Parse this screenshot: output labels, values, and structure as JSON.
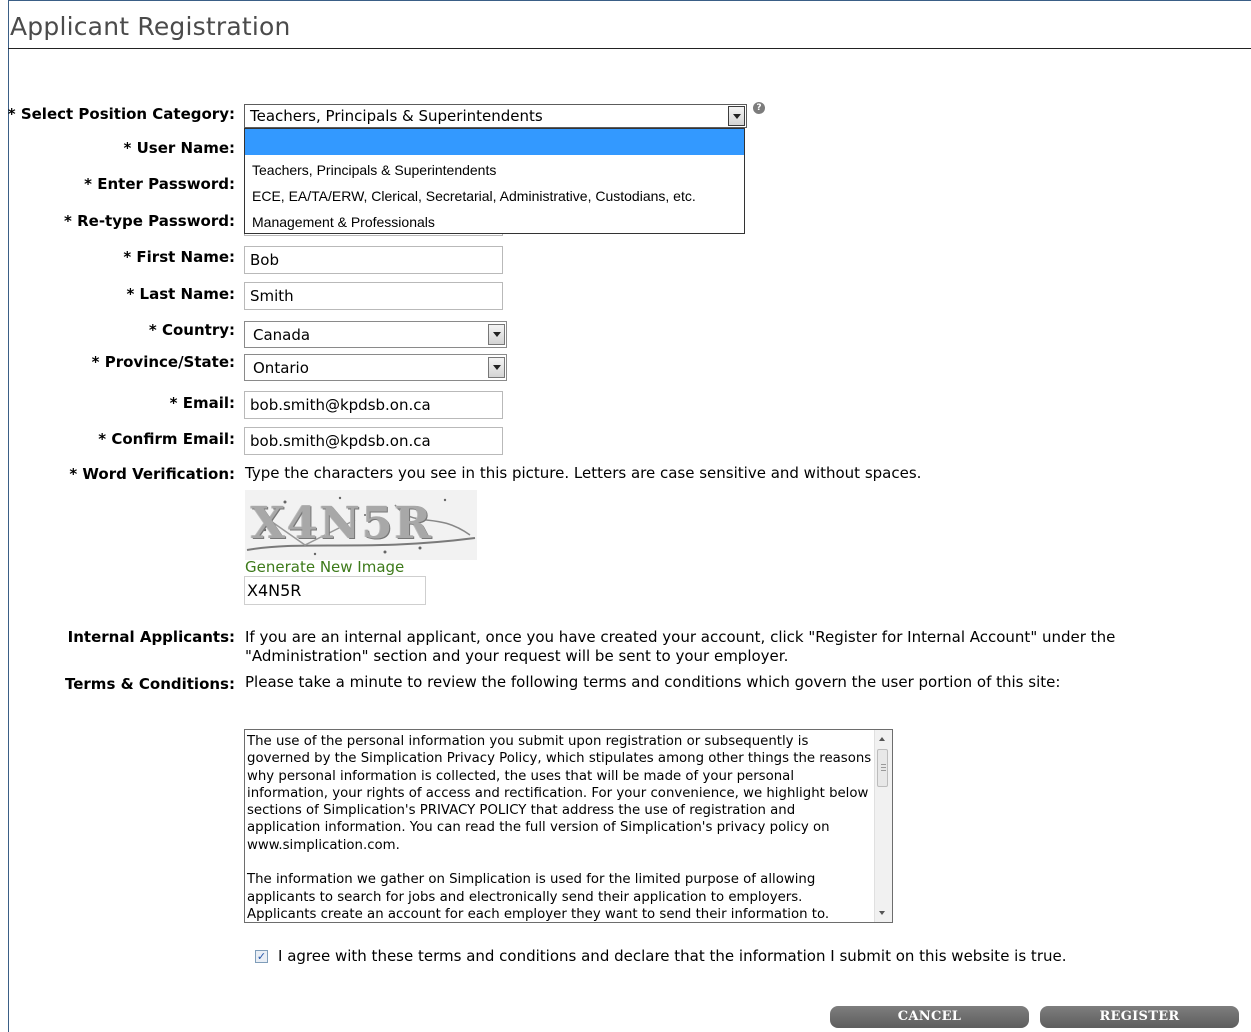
{
  "page": {
    "title": "Applicant Registration"
  },
  "form": {
    "position_category": {
      "label": "* Select Position Category:",
      "value": "Teachers, Principals & Superintendents",
      "options": [
        "",
        "Teachers, Principals & Superintendents",
        "ECE, EA/TA/ERW, Clerical, Secretarial, Administrative, Custodians, etc.",
        "Management & Professionals"
      ],
      "help_icon": "question-icon"
    },
    "user_name": {
      "label": "* User Name:",
      "value": ""
    },
    "password": {
      "label": "* Enter Password:",
      "value": ""
    },
    "retype_password": {
      "label": "* Re-type Password:",
      "value": ""
    },
    "first_name": {
      "label": "* First Name:",
      "value": "Bob"
    },
    "last_name": {
      "label": "* Last Name:",
      "value": "Smith"
    },
    "country": {
      "label": "* Country:",
      "value": "Canada"
    },
    "province": {
      "label": "* Province/State:",
      "value": "Ontario"
    },
    "email": {
      "label": "* Email:",
      "value": "bob.smith@kpdsb.on.ca"
    },
    "confirm_email": {
      "label": "* Confirm Email:",
      "value": "bob.smith@kpdsb.on.ca"
    },
    "word_verification": {
      "label": "* Word Verification:",
      "instructions": "Type the characters you see in this picture. Letters are case sensitive and without spaces.",
      "captcha_text": "X4N5R",
      "generate_link": "Generate New Image",
      "value": "X4N5R"
    },
    "internal_applicants": {
      "label": "Internal Applicants:",
      "text": "If you are an internal applicant, once you have created your account, click \"Register for Internal Account\" under the \"Administration\" section and your request will be sent to your employer."
    },
    "terms": {
      "label": "Terms & Conditions:",
      "intro": "Please take a minute to review the following terms and conditions which govern the user portion of this site:",
      "paragraph1": "The use of the personal information you submit upon registration or subsequently is governed by the Simplication Privacy Policy, which stipulates among other things the reasons why personal information is collected, the uses that will be made of your personal information, your rights of access and rectification. For your convenience, we highlight below sections of Simplication's PRIVACY POLICY that address the use of registration and application information. You can read the full version of Simplication's privacy policy on www.simplication.com.",
      "paragraph2": "The information we gather on Simplication is used for the limited purpose of allowing applicants to search for jobs and electronically send their application to employers. Applicants create an account for each employer they want to send their information to.",
      "agree_checked": true,
      "agree_text": "I agree with these terms and conditions and declare that the information I submit on this website is true."
    },
    "buttons": {
      "cancel": "CANCEL",
      "register": "REGISTER"
    }
  }
}
